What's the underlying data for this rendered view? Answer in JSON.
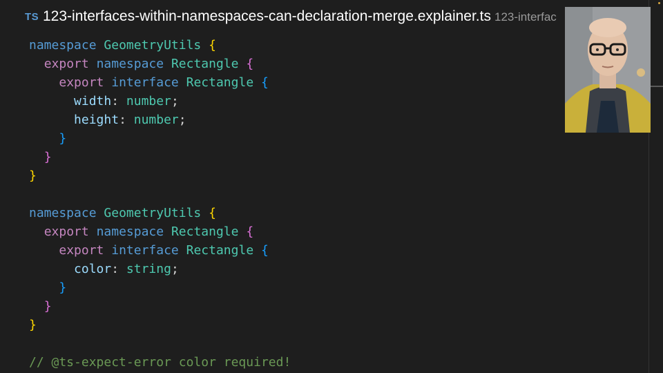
{
  "tab": {
    "language_badge": "TS",
    "title": "123-interfaces-within-namespaces-can-declaration-merge.explainer.ts",
    "description": "123-interfac"
  },
  "code": {
    "l1": {
      "kw": "namespace",
      "name": "GeometryUtils",
      "brace": "{"
    },
    "l2": {
      "export": "export",
      "kw": "namespace",
      "name": "Rectangle",
      "brace": "{"
    },
    "l3": {
      "export": "export",
      "kw": "interface",
      "name": "Rectangle",
      "brace": "{"
    },
    "l4": {
      "prop": "width",
      "colon": ":",
      "type": "number",
      "semi": ";"
    },
    "l5": {
      "prop": "height",
      "colon": ":",
      "type": "number",
      "semi": ";"
    },
    "l6": {
      "brace": "}"
    },
    "l7": {
      "brace": "}"
    },
    "l8": {
      "brace": "}"
    },
    "l10": {
      "kw": "namespace",
      "name": "GeometryUtils",
      "brace": "{"
    },
    "l11": {
      "export": "export",
      "kw": "namespace",
      "name": "Rectangle",
      "brace": "{"
    },
    "l12": {
      "export": "export",
      "kw": "interface",
      "name": "Rectangle",
      "brace": "{"
    },
    "l13": {
      "prop": "color",
      "colon": ":",
      "type": "string",
      "semi": ";"
    },
    "l14": {
      "brace": "}"
    },
    "l15": {
      "brace": "}"
    },
    "l16": {
      "brace": "}"
    },
    "l18": {
      "comment": "// @ts-expect-error color required!"
    }
  },
  "webcam": {
    "description": "presenter-video"
  }
}
